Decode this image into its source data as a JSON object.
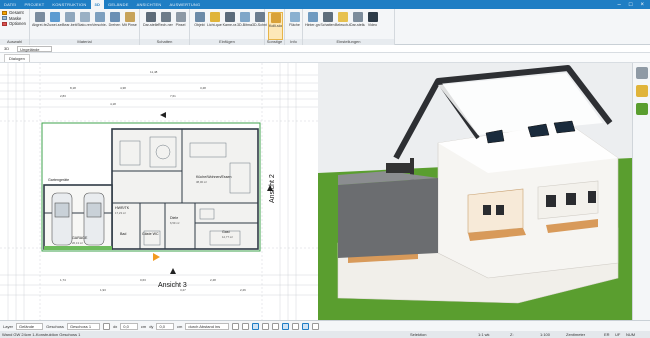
{
  "tabs": [
    "DATEI",
    "PROJEKT",
    "KONSTRUKTION",
    "3D",
    "GELÄNDE",
    "ANSICHTEN",
    "AUSWERTUNG"
  ],
  "active_tab": "3D",
  "left_quick": [
    "Gesamt",
    "Maske",
    "Optionen"
  ],
  "ribbon": {
    "groups": [
      {
        "name": "Auswahl"
      },
      {
        "name": "Material"
      },
      {
        "name": "Schatten"
      },
      {
        "name": "Einfügen"
      },
      {
        "name": "Sonstige"
      },
      {
        "name": "Info"
      },
      {
        "name": "Einstellungen"
      }
    ],
    "buttons": [
      {
        "label": "Abgrei-fen",
        "color": "#7b8c9e"
      },
      {
        "label": "Zuwei-sen",
        "color": "#5c9bd1"
      },
      {
        "label": "Bear-beiten",
        "color": "#8fa7bd"
      },
      {
        "label": "Stato-ren",
        "color": "#9ab0c4"
      },
      {
        "label": "Verschie-ben",
        "color": "#7ea0bf"
      },
      {
        "label": "Drehen",
        "color": "#6a8fb4"
      },
      {
        "label": "Mit Pinsel",
        "color": "#c7a35a"
      },
      {
        "label": "Dar-stellen",
        "color": "#5d6b78"
      },
      {
        "label": "Rech-nen",
        "color": "#6e7c89"
      },
      {
        "label": "Pinsel",
        "color": "#8d99a5"
      },
      {
        "label": "Objekt",
        "color": "#6c8ba8"
      },
      {
        "label": "Licht-quelle",
        "color": "#e0b43a"
      },
      {
        "label": "Kame-ra",
        "color": "#5b6b7a"
      },
      {
        "label": "3D-Bitmap",
        "color": "#7fa6c8"
      },
      {
        "label": "3D-Schnitt",
        "color": "#6c7d8f"
      },
      {
        "label": "Kolli-sion",
        "color": "#d9a23a"
      },
      {
        "label": "Fläche",
        "color": "#8ab0d0"
      },
      {
        "label": "Hinter-grund",
        "color": "#6f9ac0"
      },
      {
        "label": "Schatten",
        "color": "#5f6e7c"
      },
      {
        "label": "Beleuch-tung",
        "color": "#e7c14f"
      },
      {
        "label": "Dar-stellung",
        "color": "#7d8d9c"
      },
      {
        "label": "Video",
        "color": "#2d3b48"
      }
    ]
  },
  "bar2": {
    "view_label": "3D",
    "view_value": "Ungelände"
  },
  "document_tab": "Dialogen",
  "plan": {
    "rooms": [
      "Gartengeräte",
      "HWR/TK",
      "GARAGE",
      "Diele",
      "Küche/Wohnen/Essen",
      "Gast",
      "Bad",
      "Gäste WC"
    ],
    "labels": [
      "Ansicht 2",
      "Ansicht 3"
    ],
    "areas": [
      "26,13 m²",
      "17,23 m²",
      "6,59 m²",
      "38,00 m²",
      "12,77 m²"
    ],
    "dims": [
      "11,48",
      "8,18",
      "4,38",
      "3,48",
      "2,83",
      "7,61",
      "4,18",
      "1,74",
      "0,63",
      "2,48",
      "1,93",
      "3,27",
      "2,26"
    ]
  },
  "bottom": {
    "layer_label": "Layer",
    "layer_value": "Gelände",
    "floor_label": "Geschoss",
    "floor_value": "Geschoss 1",
    "dx_label": "dx",
    "dx_value": "0,0",
    "dx_unit": "cm",
    "dy_label": "dy",
    "dy_value": "0,0",
    "dy_unit": "cm",
    "extra": "durch Abstand ins"
  },
  "status": {
    "left": "Wand GW 24cm 1-Konstruktion Geschoss 1",
    "selection": "Selektion",
    "scale1": "1:1 wk",
    "coord": "Z:",
    "scale2": "1:100",
    "unit": "Zentimeter",
    "mode": "ER",
    "num": "NUM",
    "uf": "UF"
  },
  "colors": {
    "accent": "#1f7ec4",
    "grass": "#5a9e2f",
    "sky": "#e8eaed"
  }
}
